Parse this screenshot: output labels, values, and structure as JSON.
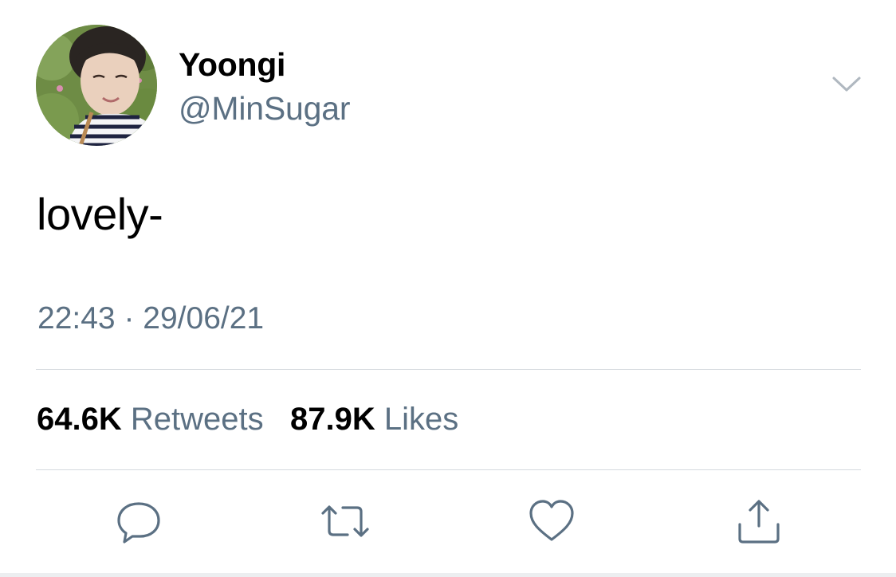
{
  "author": {
    "display_name": "Yoongi",
    "handle": "@MinSugar"
  },
  "tweet": {
    "text": "lovely-",
    "time": "22:43",
    "separator": "·",
    "date": "29/06/21"
  },
  "stats": {
    "retweets_count": "64.6K",
    "retweets_label": "Retweets",
    "likes_count": "87.9K",
    "likes_label": "Likes"
  },
  "icons": {
    "menu": "chevron-down-icon",
    "reply": "reply-icon",
    "retweet": "retweet-icon",
    "like": "heart-icon",
    "share": "share-icon"
  },
  "colors": {
    "secondary_text": "#5b7083",
    "icon": "#5b7083",
    "divider": "#d4d9de"
  }
}
